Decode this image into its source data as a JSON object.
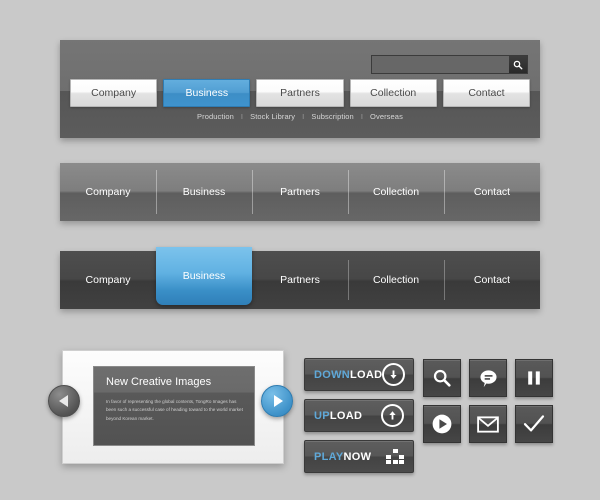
{
  "theme": {
    "background": "#c9c9c9",
    "accent_blue": "#3f93cd",
    "dark_panel": "#5c5c5c",
    "light_button": "#f2f2f2"
  },
  "header": {
    "search": {
      "value": "",
      "placeholder": "",
      "button_icon": "search-icon"
    },
    "tabs": [
      {
        "label": "Company",
        "active": false
      },
      {
        "label": "Business",
        "active": true
      },
      {
        "label": "Partners",
        "active": false
      },
      {
        "label": "Collection",
        "active": false
      },
      {
        "label": "Contact",
        "active": false
      }
    ],
    "subnav": [
      "Production",
      "Stock Library",
      "Subscription",
      "Overseas"
    ],
    "subnav_separator": "I"
  },
  "navbar_gray": {
    "tabs": [
      {
        "label": "Company",
        "active": false
      },
      {
        "label": "Business",
        "active": false
      },
      {
        "label": "Partners",
        "active": false
      },
      {
        "label": "Collection",
        "active": false
      },
      {
        "label": "Contact",
        "active": false
      }
    ]
  },
  "navbar_dark": {
    "tabs": [
      {
        "label": "Company",
        "active": false
      },
      {
        "label": "Business",
        "active": true
      },
      {
        "label": "Partners",
        "active": false
      },
      {
        "label": "Collection",
        "active": false
      },
      {
        "label": "Contact",
        "active": false
      }
    ]
  },
  "slider": {
    "title": "New Creative Images",
    "body": "In favor of representing the global contents, TongRo Images has been such a successful case of heading toward to the world market beyond Korean market.",
    "prev_icon": "chevron-left-icon",
    "next_icon": "chevron-right-icon"
  },
  "actions": [
    {
      "accent": "DOWN",
      "rest": "LOAD",
      "icon": "arrow-down-circle-icon"
    },
    {
      "accent": "UP",
      "rest": "LOAD",
      "icon": "arrow-up-circle-icon"
    },
    {
      "accent": "PLAY",
      "rest": "NOW",
      "icon": "equalizer-icon"
    }
  ],
  "icon_tiles": [
    {
      "name": "search-icon"
    },
    {
      "name": "chat-bubble-icon"
    },
    {
      "name": "pause-icon"
    },
    {
      "name": "play-circle-icon"
    },
    {
      "name": "mail-icon"
    },
    {
      "name": "check-icon"
    }
  ]
}
